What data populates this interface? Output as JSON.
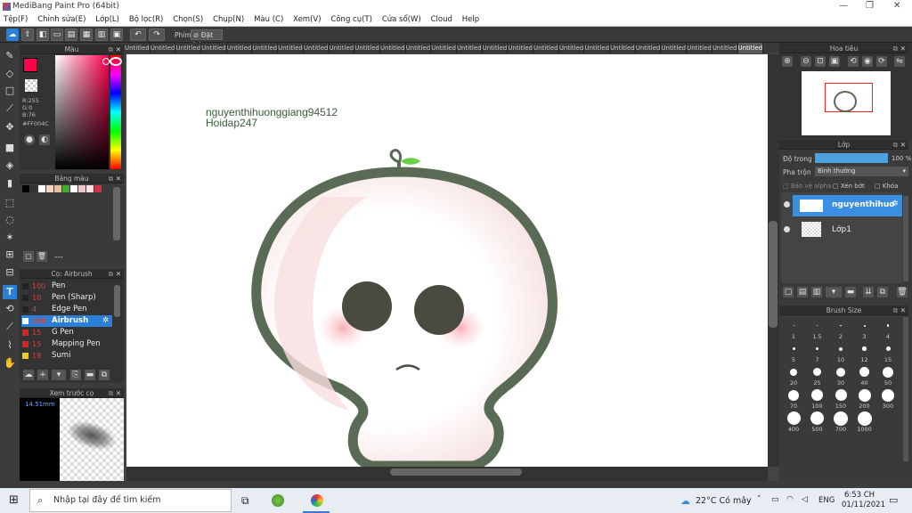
{
  "window": {
    "title": "MediBang Paint Pro (64bit)"
  },
  "menu": [
    "Tệp(F)",
    "Chỉnh sửa(E)",
    "Lớp(L)",
    "Bộ lọc(R)",
    "Chọn(S)",
    "Chụp(N)",
    "Màu (C)",
    "Xem(V)",
    "Công cụ(T)",
    "Cửa sổ(W)",
    "Cloud",
    "Help"
  ],
  "toolbar": {
    "snap_label": "Phím",
    "reset_label": "Đặt lại"
  },
  "color_panel": {
    "title": "Màu",
    "r": "R:255",
    "g": "G:0",
    "b": "B:76",
    "hex": "#FF004C",
    "primary_color": "#ff004c"
  },
  "palette_panel": {
    "title": "Bảng màu",
    "dashes": "---",
    "colors": [
      "#000000",
      "#333333",
      "#ffffff",
      "#f5d5c0",
      "#e8c0a0",
      "#44aa33",
      "#ffffff",
      "#f0c8c8",
      "#ffe0e0",
      "#cc3344"
    ]
  },
  "brush_panel": {
    "title": "Cọ: Airbrush",
    "brushes": [
      {
        "size": "100",
        "name": "Pen",
        "color": "#222222"
      },
      {
        "size": "10",
        "name": "Pen (Sharp)",
        "color": "#222222"
      },
      {
        "size": "4",
        "name": "Edge Pen",
        "color": "#222222"
      },
      {
        "size": "200",
        "name": "Airbrush",
        "color": "#ffffff"
      },
      {
        "size": "15",
        "name": "G Pen",
        "color": "#dd2222"
      },
      {
        "size": "15",
        "name": "Mapping Pen",
        "color": "#dd2222"
      },
      {
        "size": "19",
        "name": "Sumi",
        "color": "#eecc22"
      }
    ]
  },
  "preview_panel": {
    "title": "Xem trước cọ",
    "size": "14.51mm"
  },
  "tabs": [
    "Untitled",
    "Untitled",
    "Untitled",
    "Untitled",
    "Untitled",
    "Untitled",
    "Untitled",
    "Untitled",
    "Untitled",
    "Untitled",
    "Untitled",
    "Untitled",
    "Untitled",
    "Untitled",
    "Untitled",
    "Untitled",
    "Untitled",
    "Untitled",
    "Untitled",
    "Untitled",
    "Untitled",
    "Untitled",
    "Untitled",
    "Untitled",
    "Untitled"
  ],
  "canvas_text": {
    "line1": "nguyenthihuonggiang94512",
    "line2": "Hoidap247"
  },
  "navigator_panel": {
    "title": "Hoa tiêu"
  },
  "layer_panel": {
    "title": "Lớp",
    "opacity_label": "Độ trong",
    "opacity_value": "100 %",
    "opacity_fraction": 1.0,
    "blend_label": "Pha trộn",
    "blend_value": "Bình thường",
    "protect_alpha": "Bảo vệ alpha",
    "clipping": "Xén bớt",
    "lock": "Khóa",
    "layers": [
      {
        "name": "nguyenthihuonggiang94512"
      },
      {
        "name": "Lớp1"
      }
    ]
  },
  "brush_size_panel": {
    "title": "Brush Size",
    "sizes": [
      "1",
      "1.5",
      "2",
      "3",
      "4",
      "5",
      "7",
      "10",
      "12",
      "15",
      "20",
      "25",
      "30",
      "40",
      "50",
      "70",
      "100",
      "150",
      "200",
      "300",
      "400",
      "500",
      "700",
      "1000"
    ]
  },
  "taskbar": {
    "search_placeholder": "Nhập tại đây để tìm kiếm",
    "weather": "22°C  Có mây",
    "lang": "ENG",
    "time": "6:53 CH",
    "date": "01/11/2021"
  }
}
